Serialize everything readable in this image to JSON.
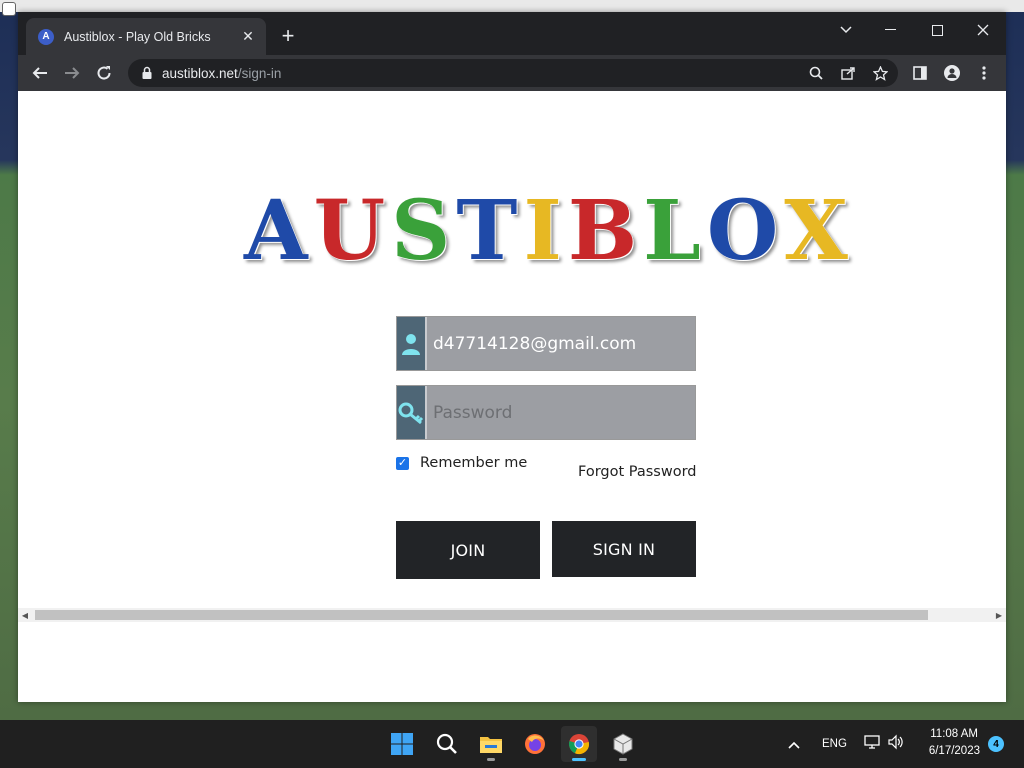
{
  "browser": {
    "tab": {
      "title": "Austiblox - Play Old Bricks",
      "favicon_letter": "A"
    },
    "url": {
      "domain": "austiblox.net",
      "path": "/sign-in"
    }
  },
  "page": {
    "logo_letters": [
      {
        "char": "A",
        "color": "#1f4aa8"
      },
      {
        "char": "U",
        "color": "#c8282a"
      },
      {
        "char": "S",
        "color": "#3aa13a"
      },
      {
        "char": "T",
        "color": "#1f4aa8"
      },
      {
        "char": "I",
        "color": "#e7b823"
      },
      {
        "char": "B",
        "color": "#c8282a"
      },
      {
        "char": "L",
        "color": "#3aa13a"
      },
      {
        "char": "O",
        "color": "#1f4aa8"
      },
      {
        "char": "X",
        "color": "#e7b823"
      }
    ],
    "email_value": "d47714128@gmail.com",
    "password_placeholder": "Password",
    "remember_label": "Remember me",
    "remember_checked": true,
    "forgot_label": "Forgot Password",
    "join_label": "JOIN",
    "signin_label": "SIGN IN"
  },
  "taskbar": {
    "language": "ENG",
    "time": "11:08 AM",
    "date": "6/17/2023",
    "notification_count": "4"
  },
  "colors": {
    "field_bg": "#9c9ea3",
    "field_icon_bg": "#4e6676",
    "button_bg": "#222427",
    "icon_cyan": "#7fe3ee"
  }
}
